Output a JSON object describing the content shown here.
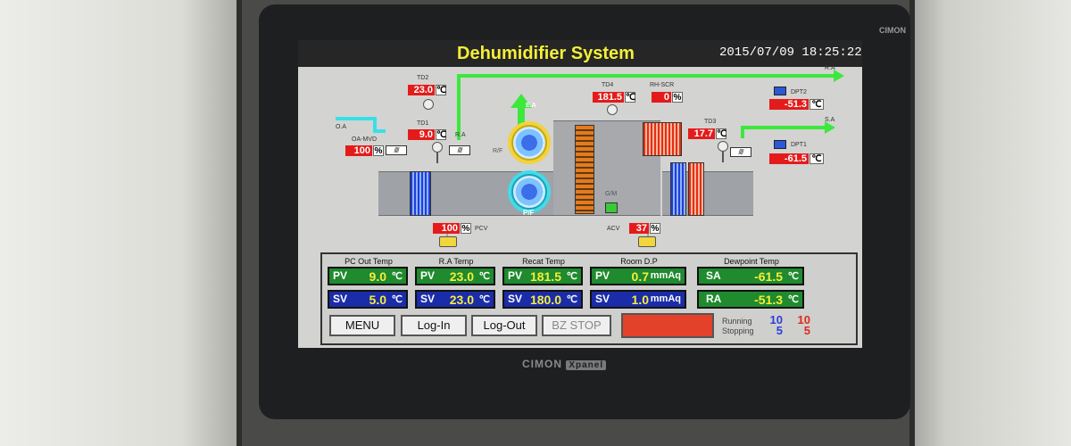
{
  "header": {
    "title": "Dehumidifier System",
    "datetime": "2015/07/09  18:25:22"
  },
  "brand": {
    "top": "CIMON",
    "bottom": "CIMON",
    "bottom_tag": "Xpanel"
  },
  "diagram": {
    "td2": {
      "label": "TD2",
      "value": "23.0",
      "unit": "℃"
    },
    "td1": {
      "label": "TD1",
      "value": "9.0",
      "unit": "℃"
    },
    "td4": {
      "label": "TD4",
      "value": "181.5",
      "unit": "℃"
    },
    "rh_scr": {
      "label": "RH-SCR",
      "value": "0",
      "unit": "%"
    },
    "td3": {
      "label": "TD3",
      "value": "17.7",
      "unit": "℃"
    },
    "dpt2": {
      "label": "DPT2",
      "value": "-51.3",
      "unit": "℃"
    },
    "dpt1": {
      "label": "DPT1",
      "value": "-61.5",
      "unit": "℃"
    },
    "oa_mvd": {
      "label": "OA-MVD",
      "value": "100",
      "unit": "%"
    },
    "pcv": {
      "label": "PCV",
      "value": "100",
      "unit": "%"
    },
    "acv": {
      "label": "ACV",
      "value": "37",
      "unit": "%"
    },
    "labels": {
      "oa": "O.A",
      "ra_left": "R.A",
      "ra_right": "R.A",
      "sa": "S.A",
      "ea": "E.A",
      "rf": "R/F",
      "pf": "P/F",
      "gm": "G/M"
    }
  },
  "panel": {
    "groups": [
      {
        "label": "PC Out Temp",
        "pv": "9.0",
        "sv": "5.0",
        "unit": "℃"
      },
      {
        "label": "R.A Temp",
        "pv": "23.0",
        "sv": "23.0",
        "unit": "℃"
      },
      {
        "label": "Recat Temp",
        "pv": "181.5",
        "sv": "180.0",
        "unit": "℃"
      },
      {
        "label": "Room D.P",
        "pv": "0.7",
        "sv": "1.0",
        "unit": "mmAq"
      }
    ],
    "pv_prefix": "PV",
    "sv_prefix": "SV",
    "dewpoint": {
      "label": "Dewpoint Temp",
      "sa_prefix": "SA",
      "sa": "-61.5",
      "ra_prefix": "RA",
      "ra": "-51.3",
      "unit": "℃"
    },
    "buttons": {
      "menu": "MENU",
      "login": "Log-In",
      "logout": "Log-Out",
      "bz_stop": "BZ STOP"
    },
    "status": {
      "running_label": "Running",
      "stopping_label": "Stopping",
      "running_blue": "10",
      "running_red": "10",
      "stopping_blue": "5",
      "stopping_red": "5"
    }
  },
  "colors": {
    "alarm": "#e4412a",
    "pv_bg": "#1f8a2e",
    "sv_bg": "#1b2ca8",
    "value_text": "#f5ee3a",
    "title": "#f3ef3a"
  }
}
